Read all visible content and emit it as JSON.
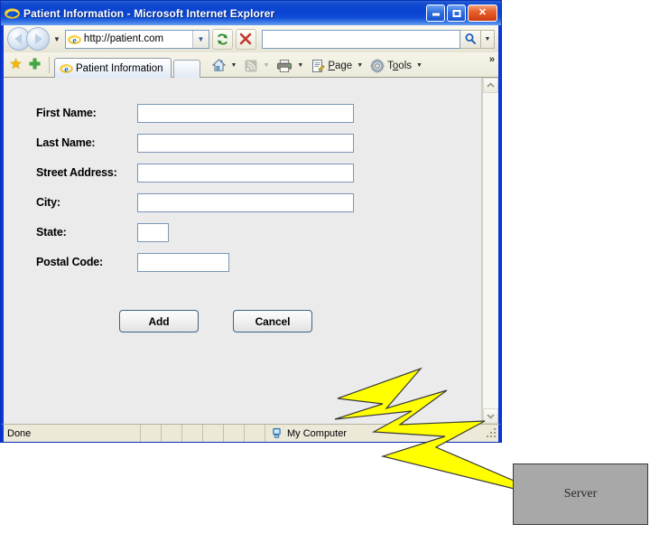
{
  "window": {
    "title": "Patient Information - Microsoft Internet Explorer",
    "icon": "ie-logo-icon",
    "controls": {
      "minimize": "Minimize",
      "maximize": "Maximize",
      "close": "Close"
    }
  },
  "toolbar": {
    "back": "Back",
    "forward": "Forward",
    "history_caret": "▼",
    "address": {
      "url": "http://patient.com",
      "dropdown": "▼"
    },
    "refresh": "Refresh",
    "stop": "Stop",
    "search": {
      "value": "",
      "placeholder": "",
      "go": "search-icon",
      "dropdown": "▼"
    }
  },
  "tabbar": {
    "favorites": "Favorites Center",
    "add_favorite": "Add to Favorites",
    "tabs": [
      {
        "label": "Patient Information",
        "active": true
      }
    ],
    "new_tab": "New Tab",
    "buttons": [
      {
        "name": "home",
        "label": "",
        "caret": "▼"
      },
      {
        "name": "feeds",
        "label": "",
        "caret": "▼"
      },
      {
        "name": "print",
        "label": "",
        "caret": "▼"
      },
      {
        "name": "page",
        "label": "Page",
        "caret": "▼"
      },
      {
        "name": "tools",
        "label": "Tools",
        "caret": "▼"
      }
    ],
    "overflow": "»"
  },
  "form": {
    "fields": [
      {
        "label": "First Name:",
        "value": "",
        "size": "wide"
      },
      {
        "label": "Last Name:",
        "value": "",
        "size": "wide"
      },
      {
        "label": "Street Address:",
        "value": "",
        "size": "wide"
      },
      {
        "label": "City:",
        "value": "",
        "size": "wide"
      },
      {
        "label": "State:",
        "value": "",
        "size": "small"
      },
      {
        "label": "Postal Code:",
        "value": "",
        "size": "medium"
      }
    ],
    "buttons": {
      "add": "Add",
      "cancel": "Cancel"
    }
  },
  "scrollbar": {
    "up": "▲",
    "down": "▼"
  },
  "statusbar": {
    "message": "Done",
    "zone": "My Computer",
    "zone_icon": "computer-icon"
  },
  "diagram": {
    "bolt_label": "lightning-bolt",
    "bolt_color": "#ffff00",
    "server_label": "Server",
    "server_color": "#a8a8a8"
  }
}
